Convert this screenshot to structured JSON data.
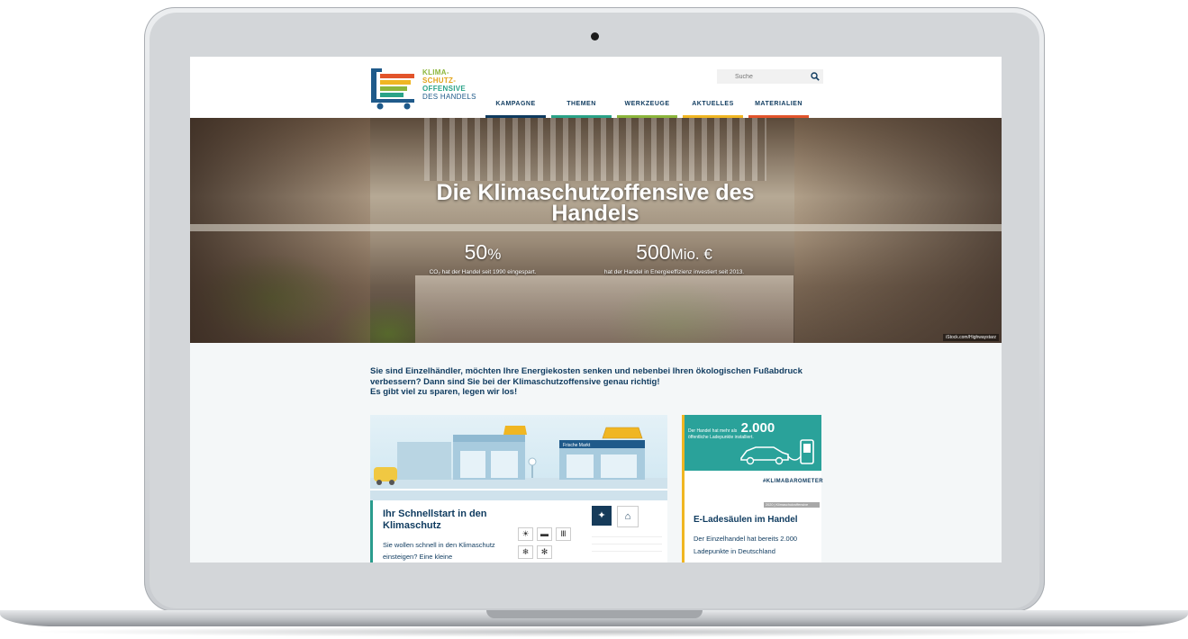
{
  "site": {
    "logo": {
      "lines": [
        "KLIMA-",
        "SCHUTZ-",
        "OFFENSIVE",
        "DES HANDELS"
      ]
    },
    "search": {
      "placeholder": "Suche"
    },
    "nav": [
      {
        "label": "KAMPAGNE",
        "color": "#0f3b5f"
      },
      {
        "label": "THEMEN",
        "color": "#2aa388"
      },
      {
        "label": "WERKZEUGE",
        "color": "#8cb63c"
      },
      {
        "label": "AKTUELLES",
        "color": "#f0b622"
      },
      {
        "label": "MATERIALIEN",
        "color": "#e2542b"
      }
    ]
  },
  "hero": {
    "title": "Die Klimaschutzoffensive des Handels",
    "stat1": {
      "value": "50",
      "unit": "%",
      "desc": "CO₂ hat der Handel seit 1990 eingespart."
    },
    "stat2": {
      "value": "500",
      "unit": "Mio. €",
      "desc": "hat der Handel in Energieeffizienz investiert seit 2013."
    },
    "credit": "iStock.com/Highwaystarz"
  },
  "intro": {
    "line1": "Sie sind Einzelhändler, möchten Ihre Energiekosten senken und nebenbei Ihren ökologischen Fußabdruck verbessern? Dann sind Sie bei der Klimaschutzoffensive genau richtig!",
    "line2": "Es gibt viel zu sparen, legen wir los!"
  },
  "card1": {
    "title": "Ihr Schnellstart in den Klimaschutz",
    "text": "Sie wollen schnell in den Klimaschutz einsteigen? Eine kleine",
    "store_sign": "Frische Markt"
  },
  "card2": {
    "stat_prefix": "Der Handel hat mehr als",
    "stat_value": "2.000",
    "stat_desc": "öffentliche Ladepunkte installiert.",
    "hashtag": "#KLIMABAROMETER",
    "badge": "2020 | Klimaschutzoffensive",
    "title": "E-Ladesäulen im Handel",
    "text": "Der Einzelhandel hat bereits 2.000 Ladepunkte in Deutschland"
  },
  "colors": {
    "primary": "#0f3b5f",
    "teal": "#2aa29a",
    "yellow": "#f0b622",
    "green": "#8cb63c",
    "red": "#e2542b"
  }
}
